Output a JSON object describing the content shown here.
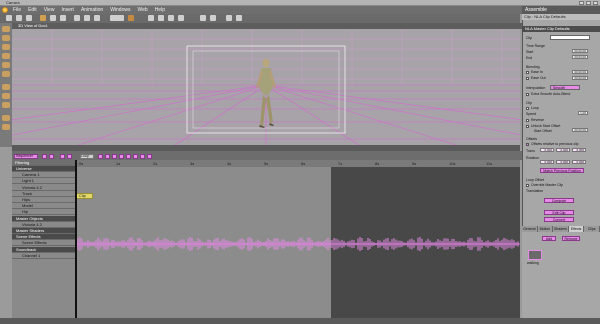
{
  "window": {
    "title": "Carrara"
  },
  "menubar": {
    "items": [
      "File",
      "Edit",
      "View",
      "Insert",
      "Animation",
      "Windows",
      "Web",
      "Help"
    ]
  },
  "right_title": "Assemble",
  "viewport": {
    "title": "3D View of Doc1",
    "camera": "Director's Mode"
  },
  "timeline": {
    "mode_label": "Sequencer",
    "filter_label": "Filtering",
    "loop_label": "Loop",
    "clip_label": "Clip",
    "ruler_ticks": [
      "0s",
      "1s",
      "2s",
      "3s",
      "4s",
      "5s",
      "6s",
      "7s",
      "8s",
      "9s",
      "10s",
      "11s"
    ],
    "tracks": [
      {
        "label": "Universe",
        "group": true
      },
      {
        "label": "Camera 1",
        "group": false
      },
      {
        "label": "Light 1",
        "group": false
      },
      {
        "label": "Victoria 4.2",
        "group": false
      },
      {
        "label": "Track",
        "group": false
      },
      {
        "label": "Hips",
        "group": false
      },
      {
        "label": "Model",
        "group": false
      },
      {
        "label": "Hip",
        "group": false
      },
      {
        "label": "Master Objects",
        "group": true
      },
      {
        "label": "Victoria 4.2",
        "group": false
      },
      {
        "label": "Master Shaders",
        "group": true
      },
      {
        "label": "Scene Effects",
        "group": true
      },
      {
        "label": "Scene Effects",
        "group": false
      },
      {
        "label": "Soundtrack",
        "group": true
      },
      {
        "label": "Channel 1",
        "group": false
      }
    ]
  },
  "panel": {
    "header": "Clip : NLA Clip Defaults",
    "section": "NLA Master Clip Defaults",
    "name_label": "Clip",
    "time_range_label": "Time Range",
    "start_label": "Start",
    "end_label": "End",
    "start_value": "00:00:00",
    "end_value": "00:03:00",
    "blending_label": "Blending",
    "ease_in_label": "Ease In",
    "ease_out_label": "Ease Out",
    "ease_in_value": "00:00:00",
    "ease_out_value": "00:00:00",
    "interp_label": "Interpolation",
    "interp_value": "Smooth",
    "extra_label": "Extra Smooth Auto-Blend",
    "clip_section": "Clip",
    "loop_label": "Loop",
    "speed_label": "Speed",
    "speed_value": "1.00",
    "reverse_label": "Reverse",
    "unlock_label": "Unlock Start Offset",
    "start_offset_label": "Start Offset",
    "start_offset_value": "00:00:00",
    "offsets_label": "Offsets",
    "offsets_rel_label": "Offsets relative to previous clip",
    "trans_label": "Trans",
    "rot_label": "Rotation",
    "offset_values": [
      "0.000",
      "0.000",
      "0.000"
    ],
    "rot_values": [
      "0.000",
      "0.000",
      "0.000"
    ],
    "match_button": "Match Previous Position",
    "loop_offset_label": "Loop Offset",
    "override_label": "Override Master Clip",
    "translation_label": "Translation",
    "compute_button": "Compute",
    "edit_clip_button": "Edit Clip",
    "convert_button": "Convert",
    "tabs": [
      "General",
      "Motion",
      "Shaders",
      "Effects",
      "Clips"
    ],
    "lib_add": "Add",
    "lib_remove": "Remove",
    "lib_item": "walking"
  }
}
